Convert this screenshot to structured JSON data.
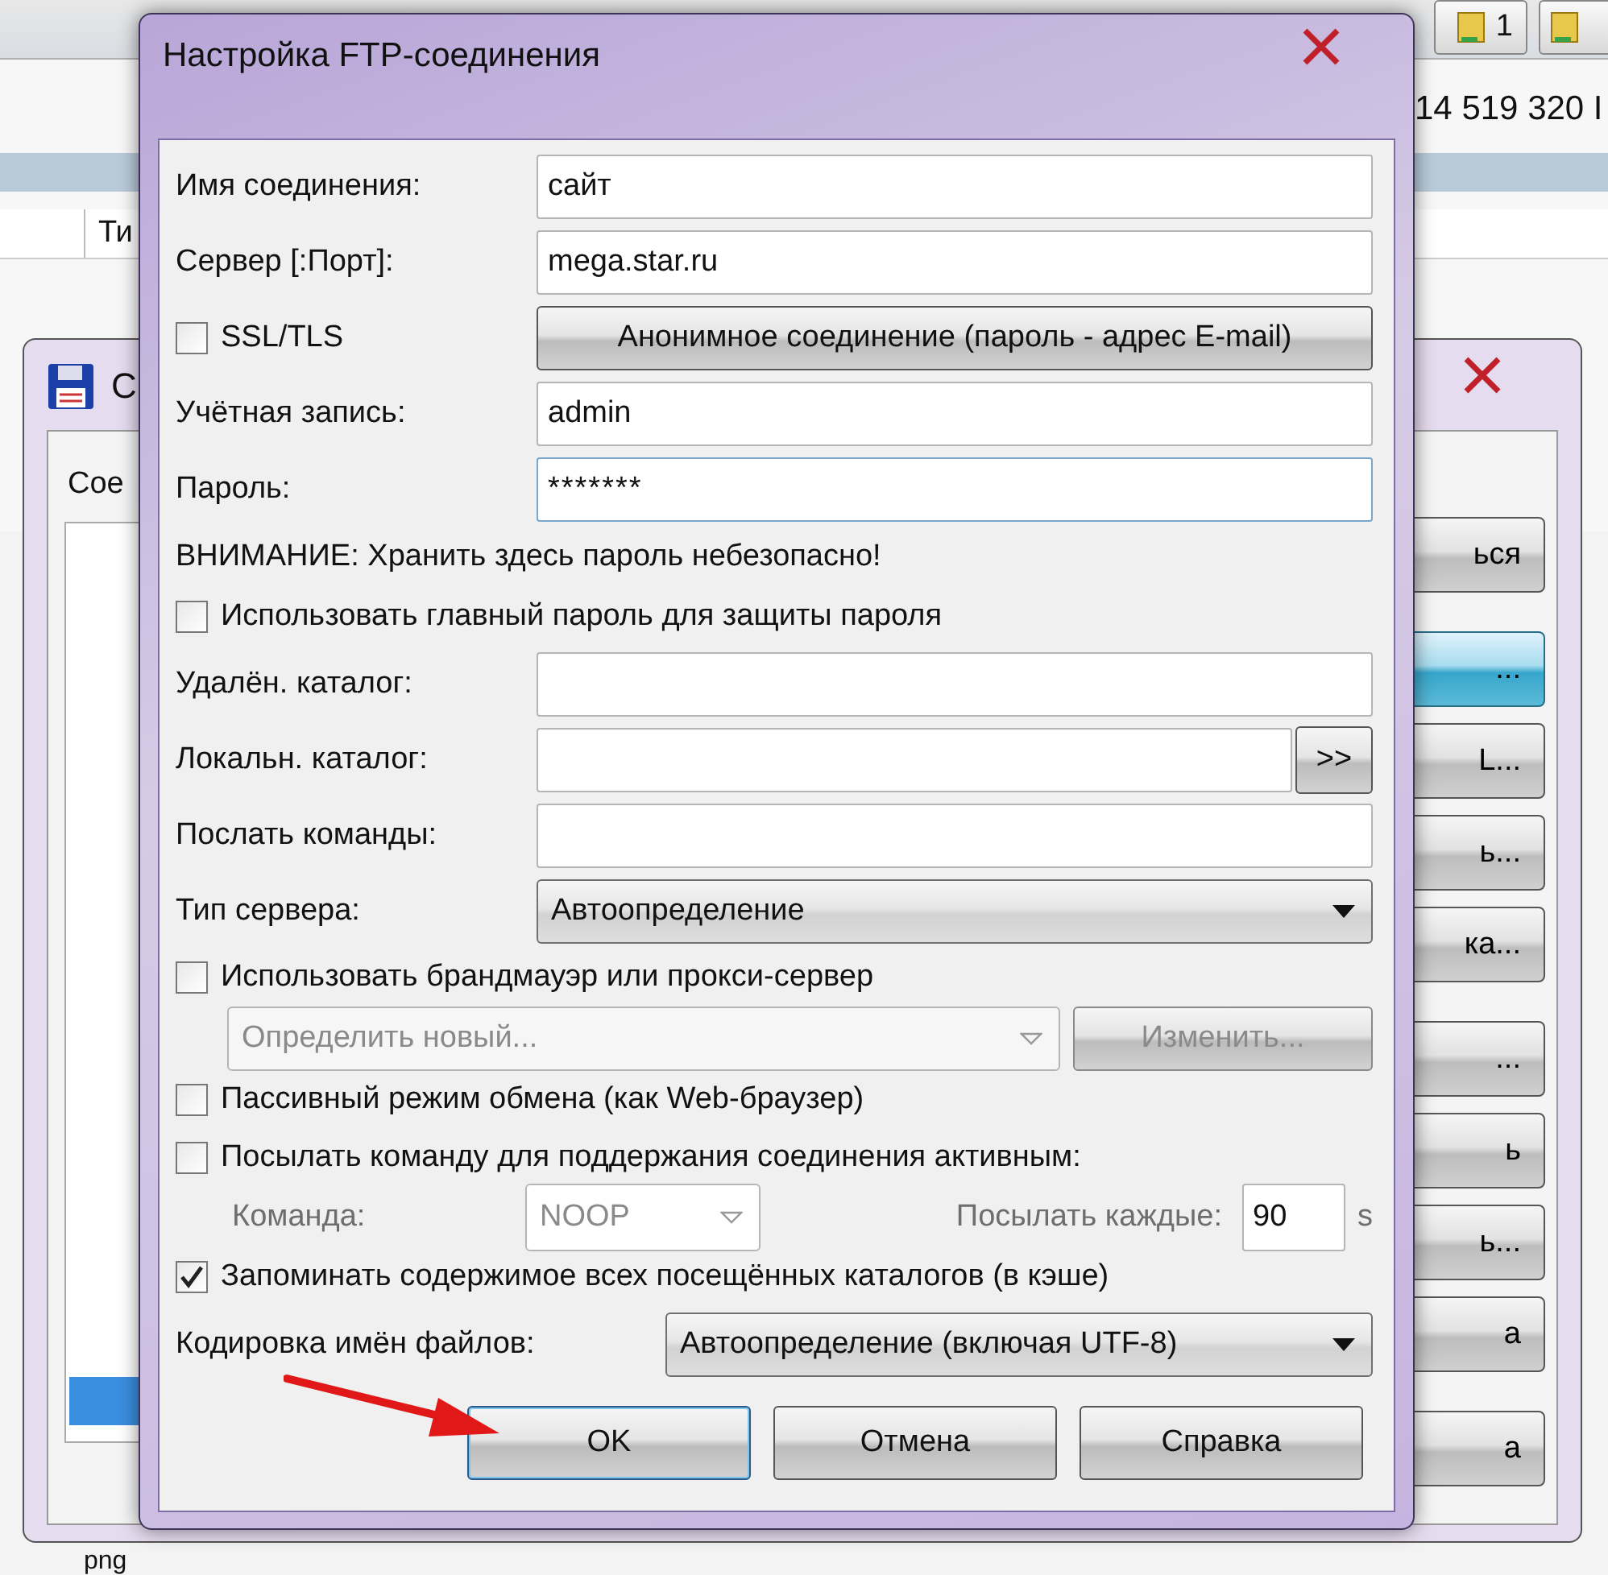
{
  "file_manager": {
    "column_header": "Ти",
    "free_space": "14 519 320 I",
    "drive_button": "1"
  },
  "back_dialog": {
    "title": "С",
    "tab": "Сое",
    "button_groups": [
      [
        {
          "label": "ься",
          "selected": false
        }
      ],
      [
        {
          "label": "...",
          "selected": true
        },
        {
          "label": "L...",
          "selected": false
        },
        {
          "label": "ь...",
          "selected": false
        },
        {
          "label": "ка...",
          "selected": false
        }
      ],
      [
        {
          "label": "...",
          "selected": false
        },
        {
          "label": "ь",
          "selected": false
        },
        {
          "label": "ь...",
          "selected": false
        },
        {
          "label": "а",
          "selected": false
        }
      ],
      [
        {
          "label": "а",
          "selected": false
        }
      ]
    ],
    "status_text": "png"
  },
  "dialog": {
    "title": "Настройка FTP-соединения",
    "rows": [
      {
        "kind": "field",
        "label": "Имя соединения:",
        "value": "сайт"
      },
      {
        "kind": "field",
        "label": "Сервер [:Порт]:",
        "value": "mega.star.ru"
      },
      {
        "kind": "checkbox_button",
        "label": "SSL/TLS",
        "checked": false,
        "button": "Анонимное соединение (пароль - адрес E-mail)"
      },
      {
        "kind": "field",
        "label": "Учётная запись:",
        "value": "admin"
      },
      {
        "kind": "field",
        "label": "Пароль:",
        "value": "*******"
      },
      {
        "kind": "text",
        "text": "ВНИМАНИЕ: Хранить здесь пароль небезопасно!"
      },
      {
        "kind": "checkbox",
        "label": "Использовать главный пароль для защиты пароля",
        "checked": false
      },
      {
        "kind": "field",
        "label": "Удалён. каталог:"
      },
      {
        "kind": "browse",
        "label": "Локальн. каталог:",
        "button": ">>"
      },
      {
        "kind": "field",
        "label": "Послать команды:"
      },
      {
        "kind": "combo",
        "label": "Тип сервера:",
        "value": "Автоопределение"
      },
      {
        "kind": "checkbox",
        "label": "Использовать брандмауэр или прокси-сервер",
        "checked": false
      },
      {
        "kind": "proxy",
        "value": "Определить новый...",
        "button": "Изменить...",
        "disabled": true
      },
      {
        "kind": "checkbox",
        "label": "Пассивный режим обмена (как Web-браузер)",
        "checked": false
      },
      {
        "kind": "checkbox",
        "label": "Посылать команду для поддержания соединения активным:",
        "checked": false
      },
      {
        "kind": "keepalive",
        "command_label": "Команда:",
        "command": "NOOP",
        "interval_label": "Посылать каждые:",
        "interval": "90",
        "unit": "s",
        "disabled": true
      },
      {
        "kind": "checkbox",
        "label": "Запоминать содержимое всех посещённых каталогов (в кэше)",
        "checked": true
      },
      {
        "kind": "wide_combo",
        "label": "Кодировка имён файлов:",
        "value": "Автоопределение (включая UTF-8)"
      }
    ],
    "buttons": [
      "OK",
      "Отмена",
      "Справка"
    ]
  }
}
